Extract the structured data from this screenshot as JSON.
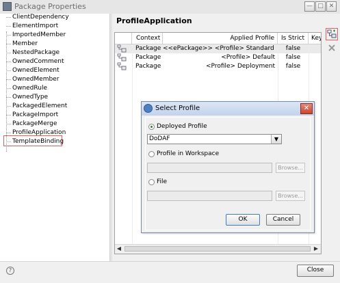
{
  "window": {
    "title": "Package Properties",
    "min_label": "—",
    "max_label": "□",
    "close_label": "✕"
  },
  "tree": {
    "items": [
      "ClientDependency",
      "ElementImport",
      "ImportedMember",
      "Member",
      "NestedPackage",
      "OwnedComment",
      "OwnedElement",
      "OwnedMember",
      "OwnedRule",
      "OwnedType",
      "PackagedElement",
      "PackageImport",
      "PackageMerge",
      "ProfileApplication",
      "TemplateBinding"
    ],
    "selected": "ProfileApplication"
  },
  "panel": {
    "title": "ProfileApplication",
    "columns": [
      "Context",
      "Applied Profile",
      "Is Strict",
      "Keyw"
    ],
    "rows": [
      {
        "context": "Package",
        "profile": "<<ePackage>> <Profile> Standard Profile",
        "strict": "false"
      },
      {
        "context": "Package",
        "profile": "<Profile> Default",
        "strict": "false"
      },
      {
        "context": "Package",
        "profile": "<Profile> Deployment",
        "strict": "false"
      }
    ]
  },
  "side_actions": {
    "add_icon": "add-profile-icon",
    "remove_icon": "remove-icon"
  },
  "dialog": {
    "title": "Select Profile",
    "close_label": "✕",
    "deployed_label": "Deployed Profile",
    "deployed_value": "DoDAF",
    "workspace_label": "Profile in Workspace",
    "workspace_value": "",
    "file_label": "File",
    "file_value": "",
    "browse_label": "Browse...",
    "ok_label": "OK",
    "cancel_label": "Cancel",
    "selected_option": "deployed"
  },
  "footer": {
    "help_label": "?",
    "close_label": "Close"
  },
  "colors": {
    "highlight_border": "#e06060",
    "dialog_title": "#c3d3ea",
    "dialog_close": "#c9462f"
  }
}
